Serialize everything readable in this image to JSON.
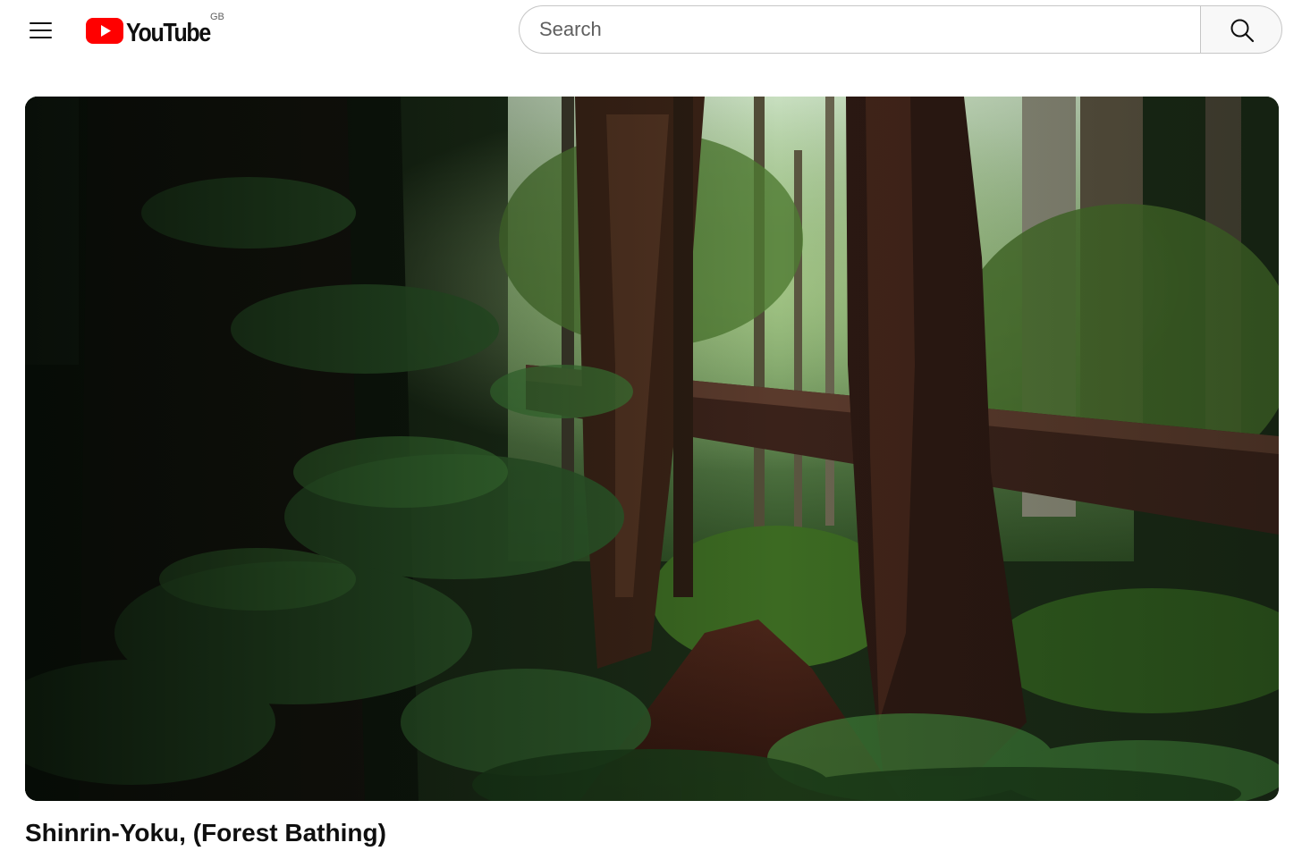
{
  "header": {
    "menu_icon": "hamburger-menu-icon",
    "logo": {
      "text": "YouTube",
      "country_code": "GB",
      "brand_color": "#ff0000"
    },
    "search": {
      "placeholder": "Search",
      "value": "",
      "button_icon": "search-icon"
    }
  },
  "player": {
    "scene": "redwood-forest-trail"
  },
  "video": {
    "title": "Shinrin-Yoku, (Forest Bathing)"
  }
}
